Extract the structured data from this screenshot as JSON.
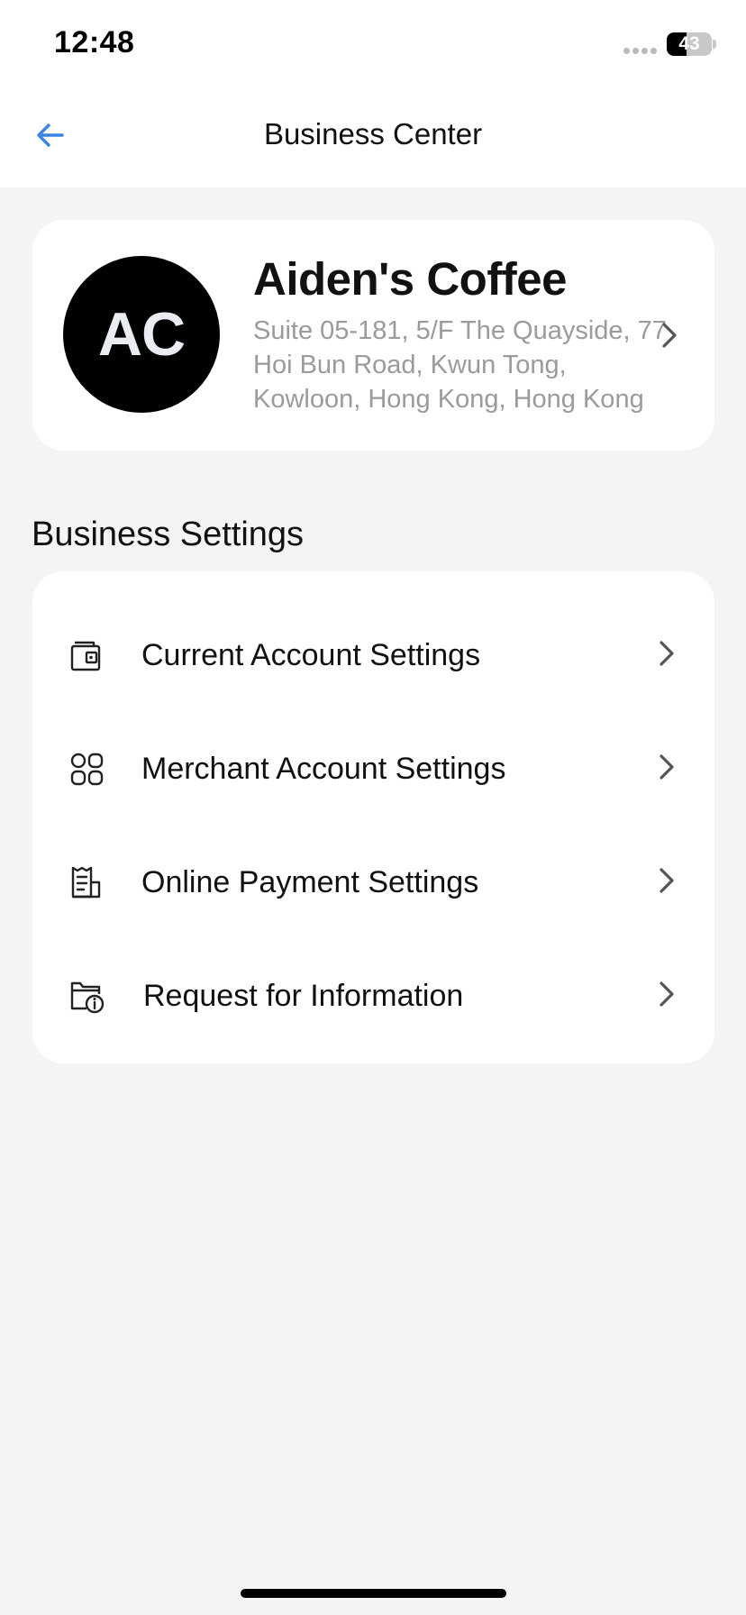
{
  "status_bar": {
    "time": "12:48",
    "battery_percent": "43"
  },
  "nav": {
    "title": "Business Center"
  },
  "profile": {
    "initials": "AC",
    "name": "Aiden's Coffee",
    "address": "Suite 05-181, 5/F The Quayside, 77 Hoi Bun Road, Kwun Tong, Kowloon, Hong Kong, Hong Kong"
  },
  "section": {
    "title": "Business Settings"
  },
  "settings_items": [
    {
      "label": "Current Account Settings",
      "icon": "wallet-icon"
    },
    {
      "label": "Merchant Account Settings",
      "icon": "grid-icon"
    },
    {
      "label": "Online Payment Settings",
      "icon": "receipt-icon"
    },
    {
      "label": "Request for Information",
      "icon": "folder-info-icon"
    }
  ],
  "colors": {
    "accent": "#3a86e0",
    "background": "#f4f4f4",
    "card": "#ffffff",
    "muted_text": "#9b9b9b"
  }
}
